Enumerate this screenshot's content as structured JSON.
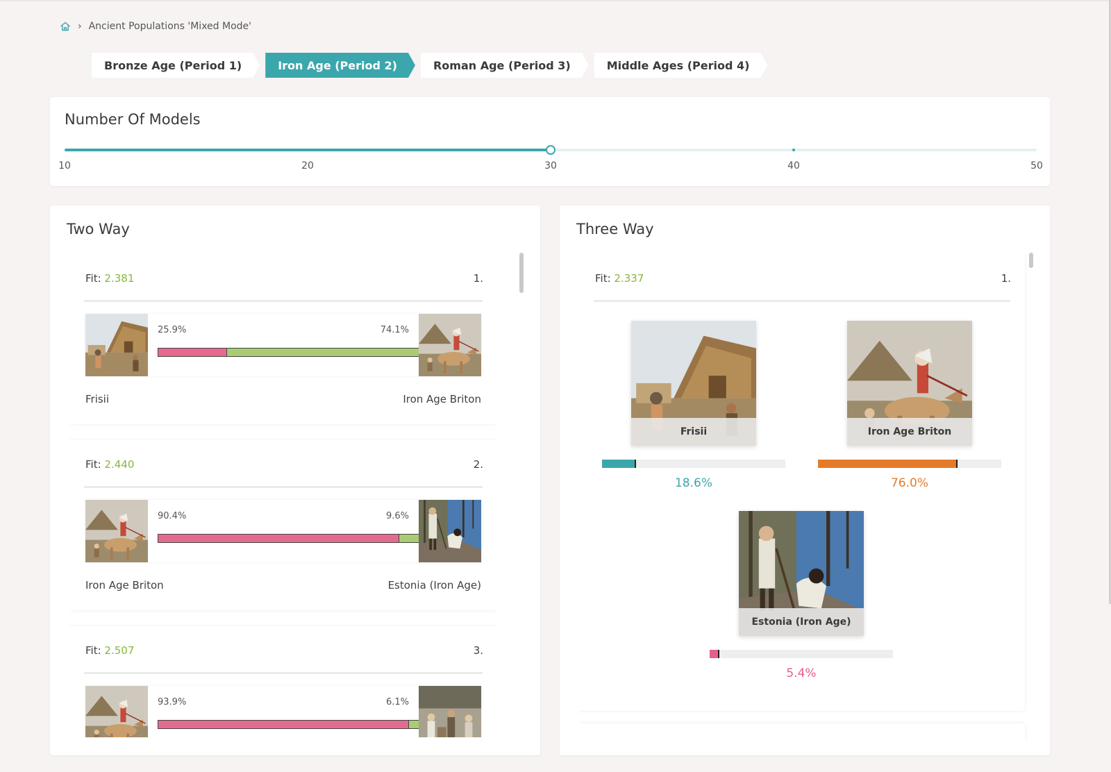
{
  "breadcrumb": {
    "home_icon": "home-icon",
    "separator": "›",
    "current": "Ancient Populations 'Mixed Mode'"
  },
  "periods": [
    {
      "label": "Bronze Age (Period 1)",
      "active": false
    },
    {
      "label": "Iron Age (Period 2)",
      "active": true
    },
    {
      "label": "Roman Age (Period 3)",
      "active": false
    },
    {
      "label": "Middle Ages (Period 4)",
      "active": false
    }
  ],
  "models": {
    "title": "Number Of Models",
    "min": 10,
    "max": 50,
    "value": 30,
    "marks": [
      "10",
      "20",
      "30",
      "40",
      "50"
    ]
  },
  "two_way": {
    "title": "Two Way",
    "results": [
      {
        "fit_label": "Fit:",
        "fit": "2.381",
        "rank": "1.",
        "left_pct": "25.9%",
        "right_pct": "74.1%",
        "left_share": 0.259,
        "left_name": "Frisii",
        "right_name": "Iron Age Briton",
        "left_img": "frisii",
        "right_img": "briton"
      },
      {
        "fit_label": "Fit:",
        "fit": "2.440",
        "rank": "2.",
        "left_pct": "90.4%",
        "right_pct": "9.6%",
        "left_share": 0.904,
        "left_name": "Iron Age Briton",
        "right_name": "Estonia (Iron Age)",
        "left_img": "briton",
        "right_img": "estonia"
      },
      {
        "fit_label": "Fit:",
        "fit": "2.507",
        "rank": "3.",
        "left_pct": "93.9%",
        "right_pct": "6.1%",
        "left_share": 0.939,
        "left_name": "",
        "right_name": "",
        "left_img": "briton",
        "right_img": "crowd"
      }
    ]
  },
  "three_way": {
    "title": "Three Way",
    "result": {
      "fit_label": "Fit:",
      "fit": "2.337",
      "rank": "1.",
      "components": [
        {
          "name": "Frisii",
          "pct": "18.6%",
          "share": 0.186,
          "color": "#3ba7ad",
          "img": "frisii"
        },
        {
          "name": "Iron Age Briton",
          "pct": "76.0%",
          "share": 0.76,
          "color": "#e57b29",
          "img": "briton"
        },
        {
          "name": "Estonia (Iron Age)",
          "pct": "5.4%",
          "share": 0.054,
          "color": "#e4608a",
          "img": "estonia"
        }
      ]
    }
  },
  "colors": {
    "accent": "#3ba7ad",
    "fit_value": "#86b73a",
    "bar_left": "#e46b8f",
    "bar_right": "#a9cc73"
  }
}
